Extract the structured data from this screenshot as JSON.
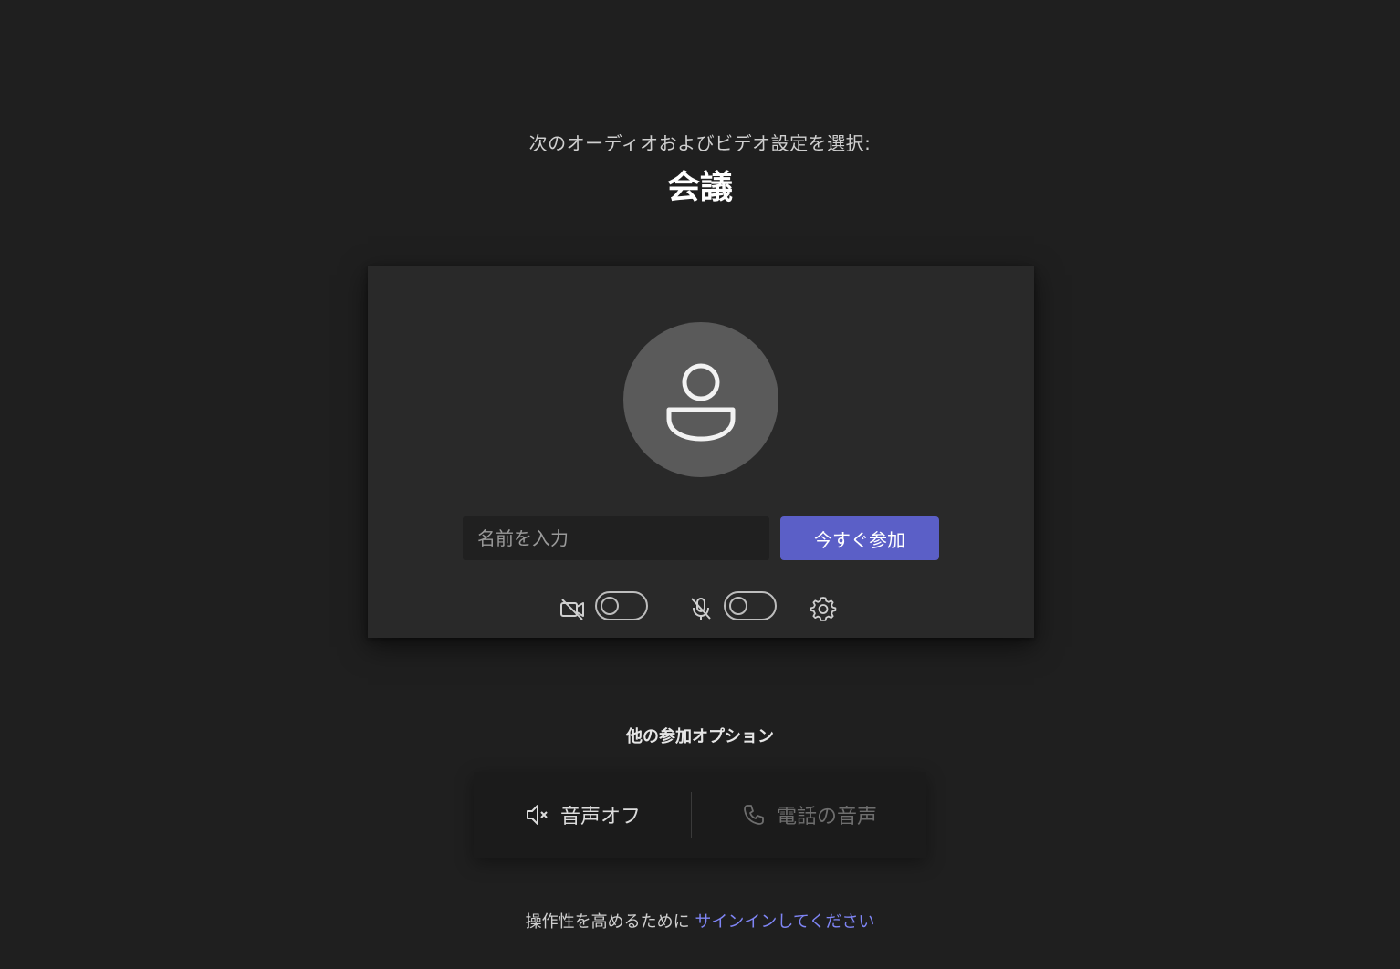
{
  "header": {
    "subtitle": "次のオーディオおよびビデオ設定を選択:",
    "title": "会議"
  },
  "prejoin": {
    "avatar_icon": "person-icon",
    "name_input": {
      "placeholder": "名前を入力",
      "value": ""
    },
    "join_button_label": "今すぐ参加",
    "controls": {
      "camera": {
        "icon": "camera-off-icon",
        "enabled": false
      },
      "microphone": {
        "icon": "mic-off-icon",
        "enabled": false
      },
      "settings": {
        "icon": "gear-icon"
      }
    }
  },
  "other_options": {
    "title": "他の参加オプション",
    "items": [
      {
        "label": "音声オフ",
        "icon": "speaker-off-icon",
        "enabled": true
      },
      {
        "label": "電話の音声",
        "icon": "phone-icon",
        "enabled": false
      }
    ]
  },
  "footer": {
    "text": "操作性を高めるために",
    "link_text": "サインインしてください"
  },
  "colors": {
    "background": "#1f1f1f",
    "card": "#292929",
    "accent": "#5b5fc7",
    "link": "#7f85f5"
  }
}
